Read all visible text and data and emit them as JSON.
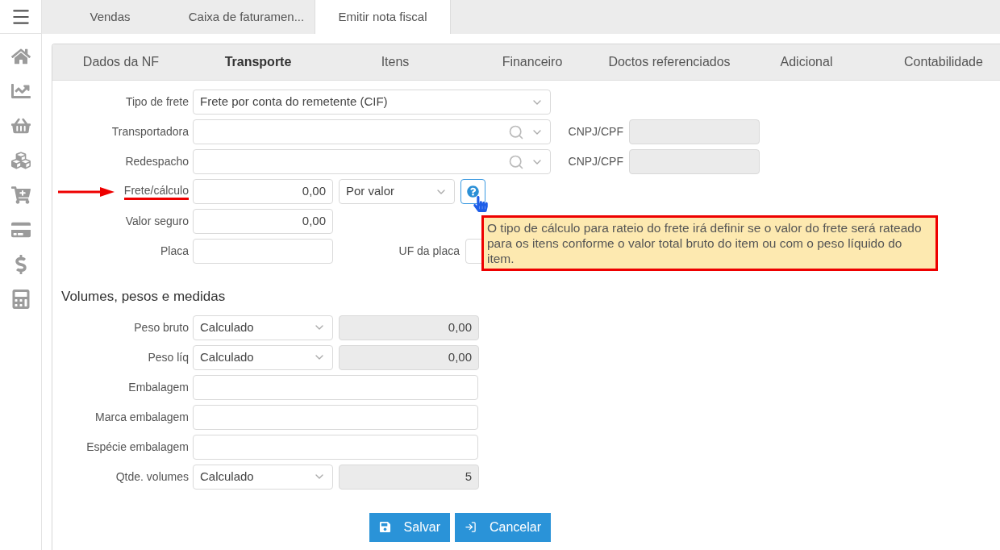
{
  "top_tabs": [
    {
      "label": "Vendas",
      "selected": false
    },
    {
      "label": "Caixa de faturamen...",
      "selected": false
    },
    {
      "label": "Emitir nota fiscal",
      "selected": true
    }
  ],
  "section_tabs": [
    {
      "label": "Dados da NF",
      "selected": false
    },
    {
      "label": "Transporte",
      "selected": true
    },
    {
      "label": "Itens",
      "selected": false
    },
    {
      "label": "Financeiro",
      "selected": false
    },
    {
      "label": "Doctos referenciados",
      "selected": false
    },
    {
      "label": "Adicional",
      "selected": false
    },
    {
      "label": "Contabilidade",
      "selected": false
    }
  ],
  "transport_rows": [
    {
      "label": "Tipo de frete",
      "annotated": false,
      "controls": [
        {
          "kind": "combo",
          "value": "Frete por conta do remetente (CIF)"
        }
      ]
    },
    {
      "label": "Transportadora",
      "annotated": false,
      "controls": [
        {
          "kind": "lookup"
        },
        {
          "kind": "caption",
          "text": "CNPJ/CPF"
        },
        {
          "kind": "document",
          "disabled": true
        }
      ]
    },
    {
      "label": "Redespacho",
      "annotated": false,
      "controls": [
        {
          "kind": "lookup"
        },
        {
          "kind": "caption",
          "text": "CNPJ/CPF"
        },
        {
          "kind": "document",
          "disabled": true
        }
      ]
    },
    {
      "label": "Frete/cálculo",
      "annotated": true,
      "controls": [
        {
          "kind": "number",
          "value": "0,00",
          "disabled": false
        },
        {
          "kind": "choice",
          "value": "Por valor"
        },
        {
          "kind": "help"
        }
      ]
    },
    {
      "label": "Valor seguro",
      "annotated": false,
      "controls": [
        {
          "kind": "number",
          "value": "0,00",
          "disabled": false
        }
      ]
    },
    {
      "label": "Placa",
      "annotated": false,
      "controls": [
        {
          "kind": "text",
          "disabled": false
        },
        {
          "kind": "caption",
          "text": "UF da placa"
        },
        {
          "kind": "state",
          "disabled": false
        }
      ]
    }
  ],
  "tooltip": {
    "text": "O tipo de cálculo para rateio do frete irá definir se o valor do frete será rateado para os itens conforme o valor total bruto do item ou com o peso líquido do item."
  },
  "volumes_heading": "Volumes, pesos e medidas",
  "volume_rows": [
    {
      "label": "Peso bruto",
      "annotated": false,
      "controls": [
        {
          "kind": "mode",
          "value": "Calculado"
        },
        {
          "kind": "number",
          "value": "0,00",
          "disabled": true
        }
      ]
    },
    {
      "label": "Peso líq",
      "annotated": false,
      "controls": [
        {
          "kind": "mode",
          "value": "Calculado"
        },
        {
          "kind": "number",
          "value": "0,00",
          "disabled": true
        }
      ]
    },
    {
      "label": "Embalagem",
      "annotated": false,
      "controls": [
        {
          "kind": "line",
          "disabled": false
        }
      ]
    },
    {
      "label": "Marca embalagem",
      "annotated": false,
      "controls": [
        {
          "kind": "line",
          "disabled": false
        }
      ]
    },
    {
      "label": "Espécie embalagem",
      "annotated": false,
      "controls": [
        {
          "kind": "line",
          "disabled": false
        }
      ]
    },
    {
      "label": "Qtde. volumes",
      "annotated": false,
      "controls": [
        {
          "kind": "mode",
          "value": "Calculado"
        },
        {
          "kind": "number",
          "value": "5",
          "disabled": true
        }
      ]
    }
  ],
  "buttons": [
    {
      "kind": "save",
      "label": "Salvar"
    },
    {
      "kind": "cancel",
      "label": "Cancelar"
    }
  ]
}
